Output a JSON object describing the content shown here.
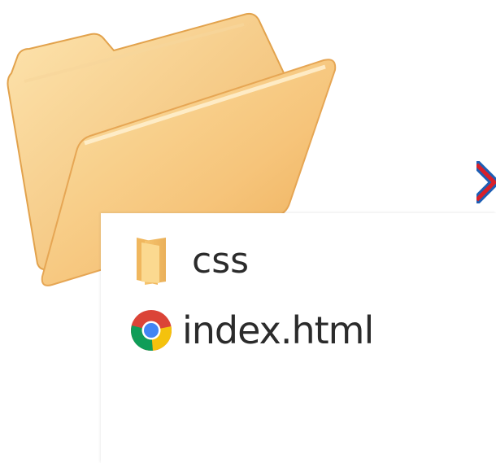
{
  "files": [
    {
      "name": "css",
      "icon": "folder-icon"
    },
    {
      "name": "index.html",
      "icon": "chrome-icon"
    }
  ],
  "colors": {
    "folder_front": "#f7c57a",
    "folder_back": "#f2b866",
    "folder_tab": "#fce0a4",
    "mark_red": "#d8202a",
    "mark_blue": "#1d5fb5",
    "chrome_red": "#db4437",
    "chrome_yellow": "#f4c20d",
    "chrome_green": "#0f9d58",
    "chrome_blue": "#4285f4"
  }
}
